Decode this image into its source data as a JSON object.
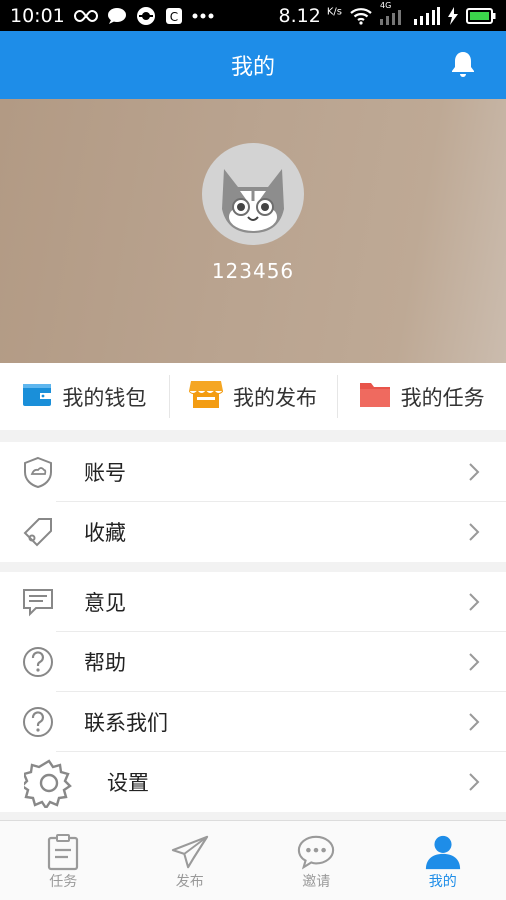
{
  "status_bar": {
    "time": "10:01",
    "speed": "8.12",
    "speed_unit": "K/s",
    "network_label": "4G"
  },
  "header": {
    "title": "我的",
    "icon": "bell-icon"
  },
  "profile": {
    "avatar": "cat-avatar",
    "username": "123456"
  },
  "quick_actions": [
    {
      "label": "我的钱包",
      "icon": "wallet-icon",
      "color": "#1a8fd9"
    },
    {
      "label": "我的发布",
      "icon": "shop-icon",
      "color": "#f39c12"
    },
    {
      "label": "我的任务",
      "icon": "folder-icon",
      "color": "#e8544a"
    }
  ],
  "menu_groups": [
    [
      {
        "label": "账号",
        "icon": "shield-icon"
      },
      {
        "label": "收藏",
        "icon": "tag-icon"
      }
    ],
    [
      {
        "label": "意见",
        "icon": "feedback-icon"
      },
      {
        "label": "帮助",
        "icon": "help-icon"
      },
      {
        "label": "联系我们",
        "icon": "contact-icon"
      },
      {
        "label": "设置",
        "icon": "gear-icon"
      }
    ]
  ],
  "tabs": [
    {
      "label": "任务",
      "icon": "clipboard-icon",
      "active": false
    },
    {
      "label": "发布",
      "icon": "paper-plane-icon",
      "active": false
    },
    {
      "label": "邀请",
      "icon": "chat-bubble-icon",
      "active": false
    },
    {
      "label": "我的",
      "icon": "person-icon",
      "active": true
    }
  ],
  "colors": {
    "primary": "#1e8de8",
    "inactive": "#9a9a9a"
  }
}
